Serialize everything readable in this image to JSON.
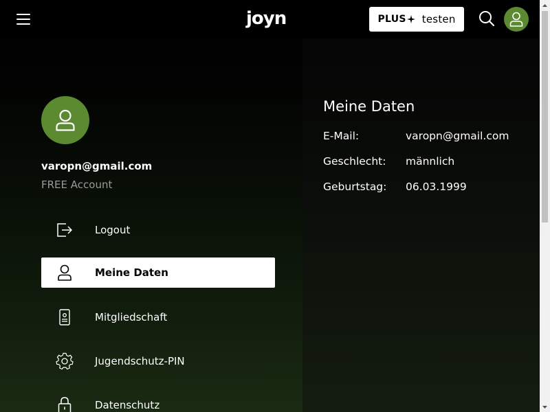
{
  "header": {
    "logo_text": "joyn",
    "plus_button": {
      "plus_label": "PLUS",
      "action_label": "testen"
    }
  },
  "profile": {
    "email": "varopn@gmail.com",
    "plan": "FREE Account"
  },
  "menu": {
    "items": [
      {
        "label": "Logout",
        "icon": "logout-icon"
      },
      {
        "label": "Meine Daten",
        "icon": "user-icon",
        "active": true
      },
      {
        "label": "Mitgliedschaft",
        "icon": "membership-card-icon"
      },
      {
        "label": "Jugendschutz-PIN",
        "icon": "gear-icon"
      },
      {
        "label": "Datenschutz",
        "icon": "lock-icon"
      }
    ]
  },
  "details": {
    "title": "Meine Daten",
    "rows": [
      {
        "key": "E-Mail:",
        "value": "varopn@gmail.com"
      },
      {
        "key": "Geschlecht:",
        "value": "männlich"
      },
      {
        "key": "Geburtstag:",
        "value": "06.03.1999"
      }
    ]
  },
  "colors": {
    "accent_green": "#5c8a30",
    "active_bg": "#ffffff",
    "muted_text": "#9a9a9a"
  }
}
